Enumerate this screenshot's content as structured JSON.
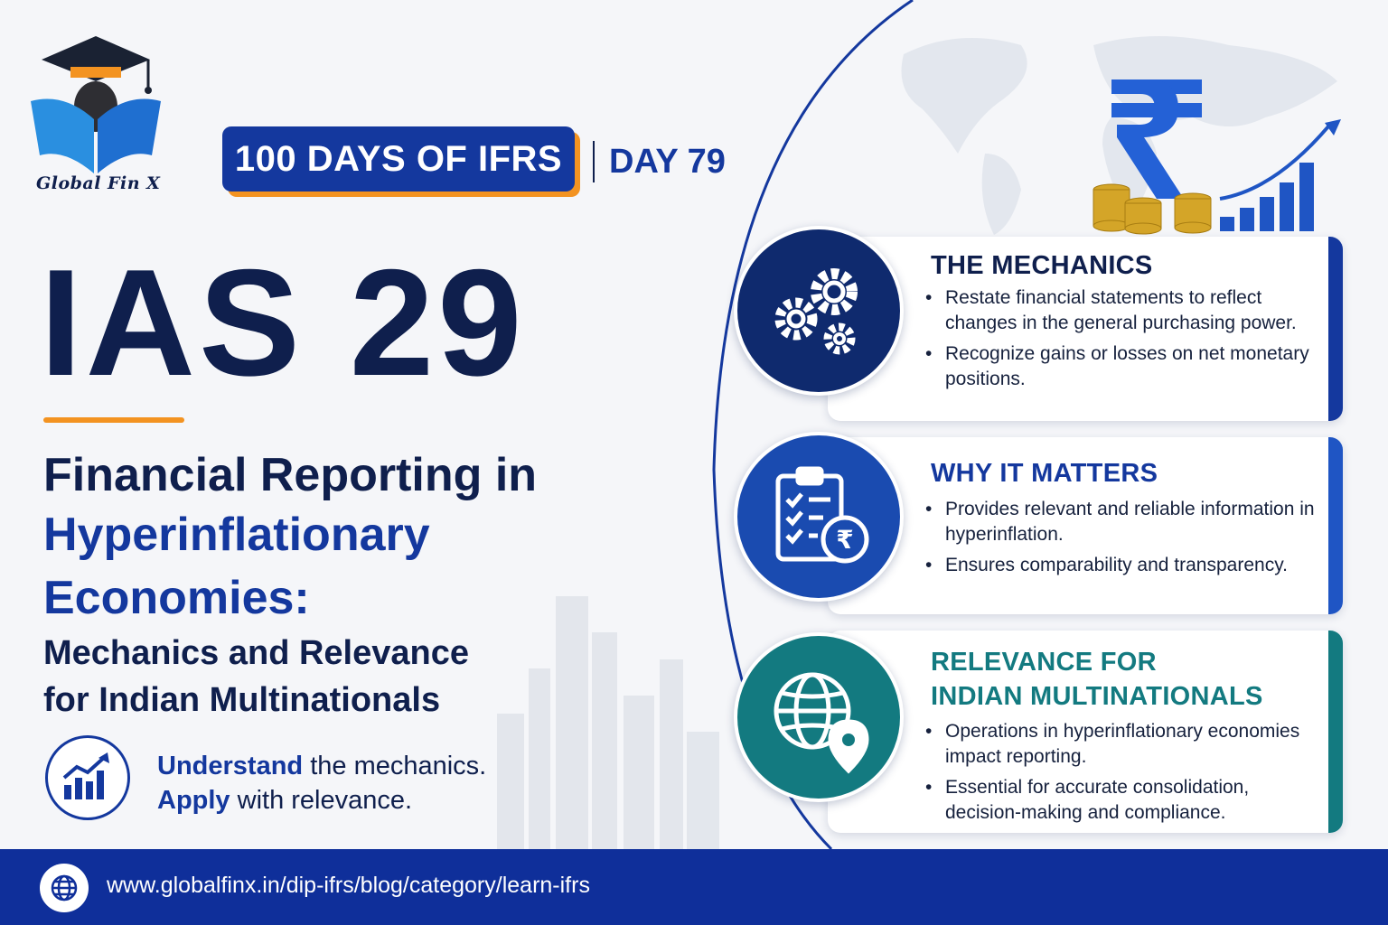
{
  "brand": {
    "name": "Global Fin X"
  },
  "header": {
    "series": "100 DAYS OF IFRS",
    "day": "DAY 79"
  },
  "title": {
    "main": "IAS 29"
  },
  "subtitle": {
    "line1": "Financial Reporting in",
    "line2": "Hyperinflationary",
    "line3": "Economies:",
    "line4": "Mechanics and Relevance",
    "line5": "for Indian Multinationals"
  },
  "tagline": {
    "word1": "Understand",
    "rest1": " the mechanics.",
    "word2": "Apply",
    "rest2": " with relevance."
  },
  "cards": [
    {
      "title": "THE MECHANICS",
      "icon": "gears-icon",
      "bullets": [
        "Restate financial statements to reflect changes in the general purchasing power.",
        "Recognize gains or losses on net monetary positions."
      ]
    },
    {
      "title": "WHY IT MATTERS",
      "icon": "checklist-rupee-icon",
      "bullets": [
        "Provides relevant and reliable information in hyperinflation.",
        "Ensures comparability and transparency."
      ]
    },
    {
      "title_line1": "RELEVANCE FOR",
      "title_line2": "INDIAN MULTINATIONALS",
      "icon": "globe-location-icon",
      "bullets": [
        "Operations in hyperinflationary economies impact reporting.",
        "Essential for accurate consolidation, decision-making and compliance."
      ]
    }
  ],
  "footer": {
    "url": "www.globalfinx.in/dip-ifrs/blog/category/learn-ifrs",
    "icon": "globe-icon"
  },
  "colors": {
    "navy": "#0f1f4d",
    "blue": "#14389e",
    "orange": "#f39321",
    "teal": "#137a80"
  }
}
